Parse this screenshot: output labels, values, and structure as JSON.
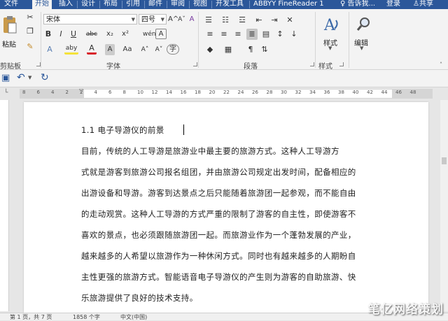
{
  "tabs": [
    "文件",
    "开始",
    "插入",
    "设计",
    "布局",
    "引用",
    "邮件",
    "审阅",
    "视图",
    "开发工具",
    "ABBYY FineReader 1"
  ],
  "active_tab_index": 1,
  "tell_me": "告诉我...",
  "sign_in": "登录",
  "share": "共享",
  "ribbon": {
    "clipboard": {
      "paste": "粘贴",
      "label": "剪贴板"
    },
    "font": {
      "name": "宋体",
      "size": "四号",
      "bold": "B",
      "italic": "I",
      "underline": "U",
      "strike": "abc",
      "sub": "x₂",
      "sup": "x²",
      "clear": "A",
      "phonetic": "wén",
      "border": "A",
      "grow": "A^",
      "shrink": "Aˇ",
      "case": "Aa",
      "highlight": "aby",
      "color": "A",
      "shade": "A",
      "enclose": "字",
      "label": "字体"
    },
    "paragraph": {
      "label": "段落"
    },
    "styles": {
      "button": "样式",
      "label": "样式"
    },
    "editing": {
      "button": "编辑"
    }
  },
  "ruler_numbers": [
    "8",
    "6",
    "4",
    "2",
    "2",
    "4",
    "6",
    "8",
    "10",
    "12",
    "14",
    "16",
    "18",
    "20",
    "22",
    "24",
    "26",
    "28",
    "30",
    "32",
    "34",
    "36",
    "38",
    "40",
    "42",
    "44",
    "46",
    "48"
  ],
  "document": {
    "heading": "1.1  电子导游仪的前景",
    "lines": [
      "        目前，传统的人工导游是旅游业中最主要的旅游方式。这种人工导游方",
      "式就是游客到旅游公司报名组团，并由旅游公司规定出发时间，配备相应的",
      "出游设备和导游。游客到达景点之后只能随着旅游团一起参观，而不能自由",
      "的走动观赏。这种人工导游的方式严重的限制了游客的自主性，即使游客不",
      "喜欢的景点，也必须跟随旅游团一起。而旅游业作为一个蓬勃发展的产业，",
      "越来越多的人希望以旅游作为一种休闲方式。同时也有越来越多的人期盼自",
      "主性更强的旅游方式。智能语音电子导游仪的产生则为游客的自助旅游、快",
      "乐旅游提供了良好的技术支持。"
    ]
  },
  "status": {
    "page": "第 1 页，共 7 页",
    "words": "1858 个字",
    "lang": "中文(中国)"
  },
  "watermark": "笔亿网络策划"
}
